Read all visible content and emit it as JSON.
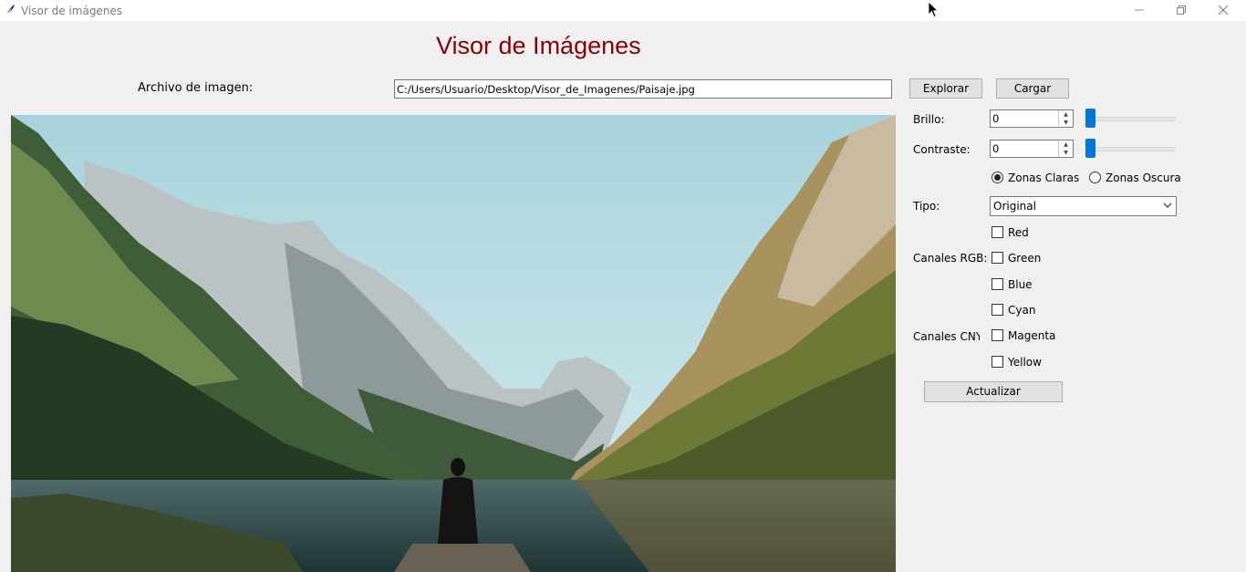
{
  "window": {
    "title": "Visor de imágenes",
    "minimize_icon": "minimize-icon",
    "maximize_icon": "restore-icon",
    "close_icon": "close-icon"
  },
  "header": {
    "title": "Visor de Imágenes",
    "title_color": "#8b0000"
  },
  "file": {
    "label": "Archivo de imagen:",
    "path_value": "C:/Users/Usuario/Desktop/Visor_de_Imagenes/Paisaje.jpg",
    "explore_label": "Explorar",
    "load_label": "Cargar"
  },
  "controls": {
    "brillo_label": "Brillo:",
    "brillo_value": "0",
    "contraste_label": "Contraste:",
    "contraste_value": "0",
    "accent_color": "#0078d7",
    "zones": {
      "claras_label": "Zonas Claras",
      "oscura_label": "Zonas Oscura",
      "selected": "claras"
    },
    "tipo_label": "Tipo:",
    "tipo_value": "Original",
    "rgb_label": "Canales RGB:",
    "rgb_channels": [
      "Red",
      "Green",
      "Blue"
    ],
    "cmyk_label": "Canales CNYK",
    "cmyk_channels": [
      "Cyan",
      "Magenta",
      "Yellow"
    ],
    "update_label": "Actualizar"
  },
  "image": {
    "description_icon": "landscape-image"
  }
}
